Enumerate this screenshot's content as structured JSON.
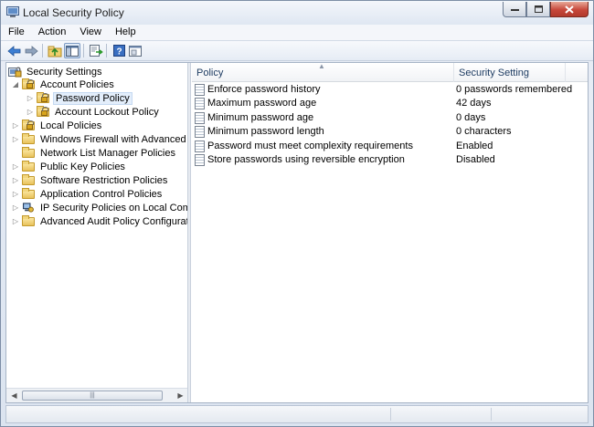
{
  "window": {
    "title": "Local Security Policy"
  },
  "menu": [
    "File",
    "Action",
    "View",
    "Help"
  ],
  "toolbar": {
    "buttons": [
      "back-icon",
      "forward-icon",
      "up-folder-icon",
      "show-hide-tree-icon",
      "export-list-icon",
      "help-icon",
      "properties-icon"
    ]
  },
  "tree": {
    "root": "Security Settings",
    "items": [
      {
        "label": "Account Policies",
        "level": 1,
        "expanded": true,
        "icon": "folder-lock-icon"
      },
      {
        "label": "Password Policy",
        "level": 2,
        "selected": true,
        "icon": "folder-lock-icon"
      },
      {
        "label": "Account Lockout Policy",
        "level": 2,
        "icon": "folder-lock-icon"
      },
      {
        "label": "Local Policies",
        "level": 1,
        "icon": "folder-icon"
      },
      {
        "label": "Windows Firewall with Advanced Secu",
        "level": 1,
        "icon": "folder-icon"
      },
      {
        "label": "Network List Manager Policies",
        "level": 1,
        "icon": "folder-icon"
      },
      {
        "label": "Public Key Policies",
        "level": 1,
        "icon": "folder-icon"
      },
      {
        "label": "Software Restriction Policies",
        "level": 1,
        "icon": "folder-icon"
      },
      {
        "label": "Application Control Policies",
        "level": 1,
        "icon": "folder-icon"
      },
      {
        "label": "IP Security Policies on Local Compute",
        "level": 1,
        "icon": "ipsec-icon"
      },
      {
        "label": "Advanced Audit Policy Configuration",
        "level": 1,
        "icon": "folder-icon"
      }
    ]
  },
  "list": {
    "columns": [
      "Policy",
      "Security Setting"
    ],
    "rows": [
      {
        "policy": "Enforce password history",
        "setting": "0 passwords remembered"
      },
      {
        "policy": "Maximum password age",
        "setting": "42 days"
      },
      {
        "policy": "Minimum password age",
        "setting": "0 days"
      },
      {
        "policy": "Minimum password length",
        "setting": "0 characters"
      },
      {
        "policy": "Password must meet complexity requirements",
        "setting": "Enabled"
      },
      {
        "policy": "Store passwords using reversible encryption",
        "setting": "Disabled"
      }
    ]
  }
}
